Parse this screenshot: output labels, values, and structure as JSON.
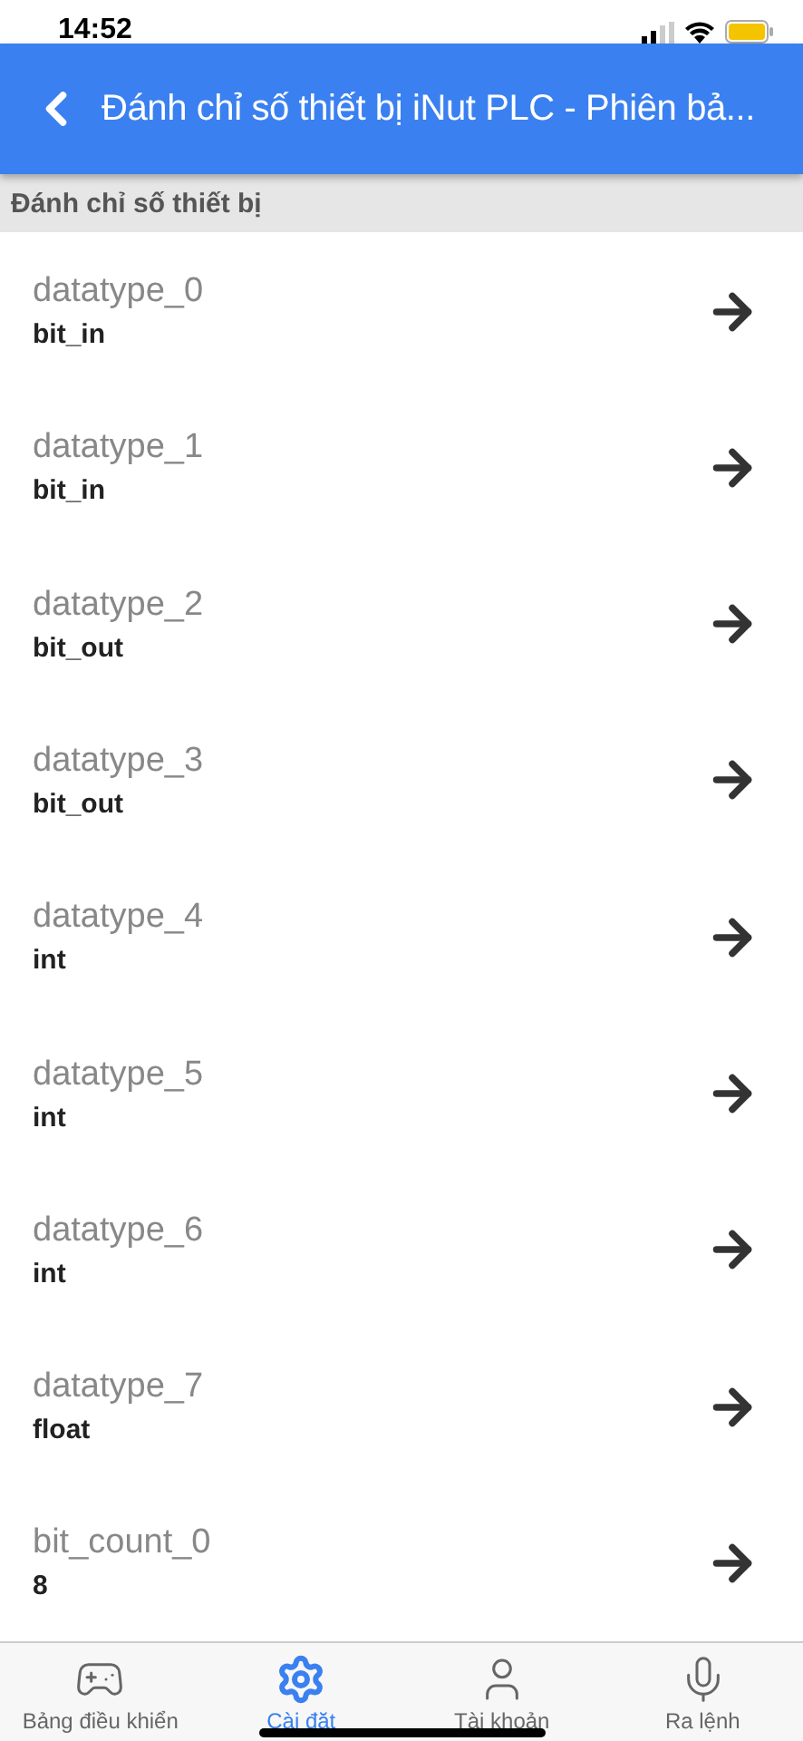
{
  "status_bar": {
    "time": "14:52"
  },
  "header": {
    "title": "Đánh chỉ số thiết bị iNut PLC - Phiên bả..."
  },
  "section": {
    "title": "Đánh chỉ số thiết bị"
  },
  "rows": [
    {
      "name": "datatype_0",
      "value": "bit_in"
    },
    {
      "name": "datatype_1",
      "value": "bit_in"
    },
    {
      "name": "datatype_2",
      "value": "bit_out"
    },
    {
      "name": "datatype_3",
      "value": "bit_out"
    },
    {
      "name": "datatype_4",
      "value": "int"
    },
    {
      "name": "datatype_5",
      "value": "int"
    },
    {
      "name": "datatype_6",
      "value": "int"
    },
    {
      "name": "datatype_7",
      "value": "float"
    },
    {
      "name": "bit_count_0",
      "value": "8"
    }
  ],
  "tabs": [
    {
      "kind": "gamepad",
      "label": "Bảng điều khiển",
      "selected": false
    },
    {
      "kind": "settings",
      "label": "Cài đặt",
      "selected": true
    },
    {
      "kind": "user",
      "label": "Tài khoản",
      "selected": false
    },
    {
      "kind": "mic",
      "label": "Ra lệnh",
      "selected": false
    }
  ]
}
